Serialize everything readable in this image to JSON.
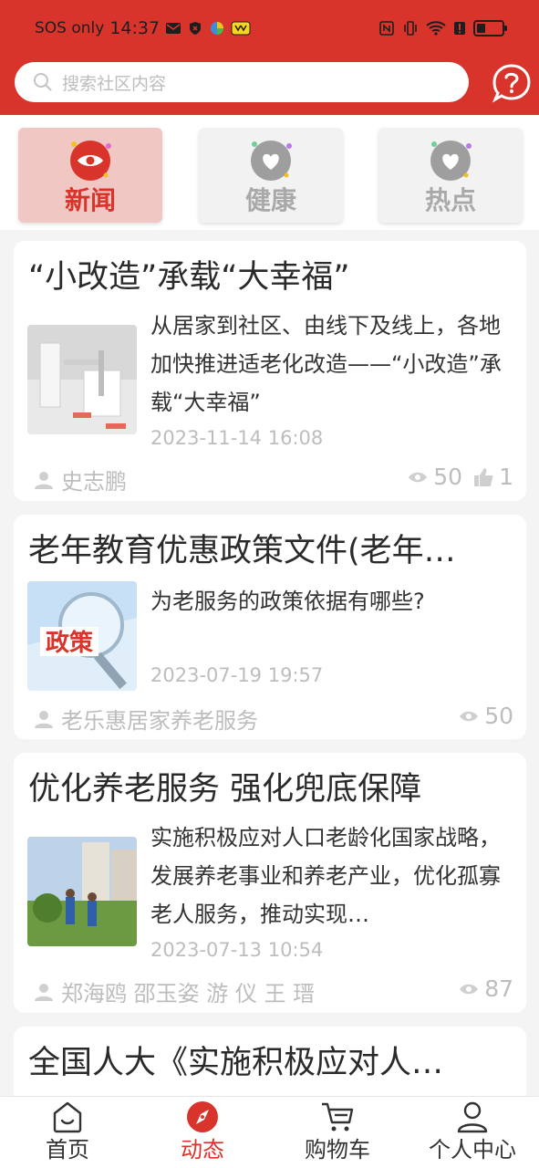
{
  "status_bar": {
    "carrier": "SOS only",
    "time": "14:37"
  },
  "search": {
    "placeholder": "搜索社区内容"
  },
  "categories": [
    {
      "label": "新闻",
      "active": true
    },
    {
      "label": "健康",
      "active": false
    },
    {
      "label": "热点",
      "active": false
    }
  ],
  "articles": [
    {
      "title": "“小改造”承载“大幸福”",
      "summary": "从居家到社区、由线下及线上，各地加快推进适老化改造——“小改造”承载“大幸福”",
      "date": "2023-11-14 16:08",
      "author": "史志鹏",
      "views": "50",
      "likes": "1"
    },
    {
      "title": "老年教育优惠政策文件(老年…",
      "summary": "为老服务的政策依据有哪些?",
      "date": "2023-07-19 19:57",
      "author": "老乐惠居家养老服务",
      "views": "50",
      "thumb_text": "政策"
    },
    {
      "title": "优化养老服务 强化兜底保障",
      "summary": "实施积极应对人口老龄化国家战略，发展养老事业和养老产业，优化孤寡老人服务，推动实现…",
      "date": "2023-07-13 10:54",
      "author": "郑海鸥 邵玉姿 游 仪 王 瑨",
      "views": "87"
    },
    {
      "title": "全国人大《实施积极应对人…"
    }
  ],
  "bottom_nav": [
    {
      "label": "首页",
      "icon": "home-icon",
      "active": false
    },
    {
      "label": "动态",
      "icon": "compass-icon",
      "active": true
    },
    {
      "label": "购物车",
      "icon": "cart-icon",
      "active": false
    },
    {
      "label": "个人中心",
      "icon": "user-icon",
      "active": false
    }
  ],
  "colors": {
    "brand_red": "#d9342b",
    "muted": "#bdbdbd"
  }
}
